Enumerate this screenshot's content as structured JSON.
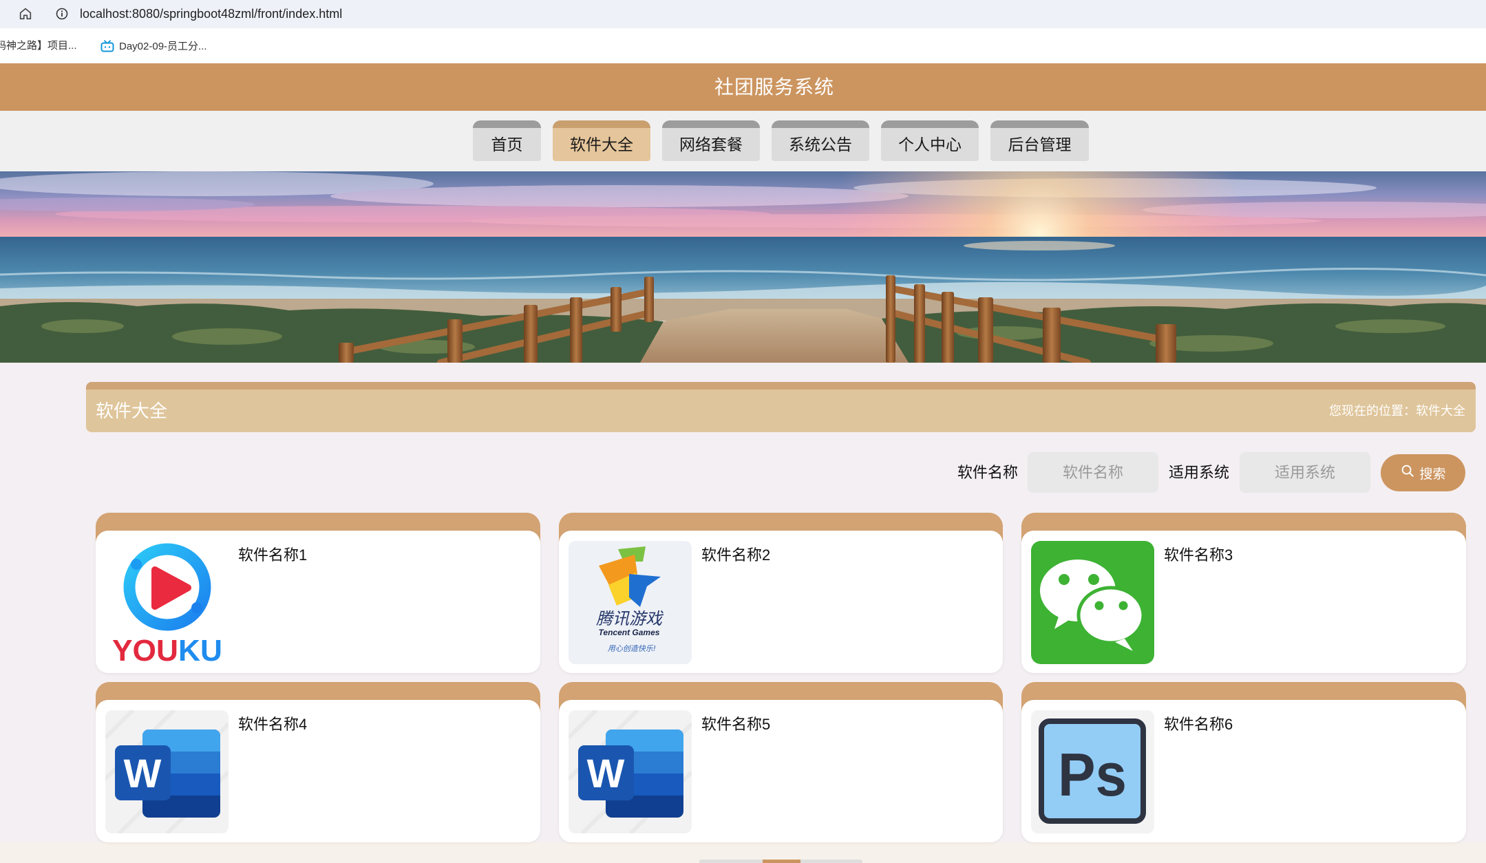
{
  "browser": {
    "url": "localhost:8080/springboot48zml/front/index.html",
    "bookmarks": [
      {
        "label": "码神之路】项目..."
      },
      {
        "label": "Day02-09-员工分...",
        "icon": "tv-icon"
      }
    ]
  },
  "header": {
    "title": "社团服务系统"
  },
  "nav": {
    "items": [
      {
        "label": "首页",
        "active": false
      },
      {
        "label": "软件大全",
        "active": true
      },
      {
        "label": "网络套餐",
        "active": false
      },
      {
        "label": "系统公告",
        "active": false
      },
      {
        "label": "个人中心",
        "active": false
      },
      {
        "label": "后台管理",
        "active": false
      }
    ]
  },
  "section": {
    "title": "软件大全",
    "location": "您现在的位置：软件大全"
  },
  "search": {
    "name_label": "软件名称",
    "name_placeholder": "软件名称",
    "name_value": "",
    "system_label": "适用系统",
    "system_placeholder": "适用系统",
    "system_value": "",
    "button_label": "搜索",
    "button_icon": "search-icon"
  },
  "software": [
    {
      "name": "软件名称1",
      "logo": "youku-logo",
      "logo_text": [
        "YOU",
        "KU"
      ]
    },
    {
      "name": "软件名称2",
      "logo": "tencent-games-logo",
      "logo_text": [
        "腾讯游戏",
        "Tencent Games",
        "用心创造快乐!"
      ]
    },
    {
      "name": "软件名称3",
      "logo": "wechat-logo"
    },
    {
      "name": "软件名称4",
      "logo": "word-logo",
      "logo_text": [
        "W"
      ]
    },
    {
      "name": "软件名称5",
      "logo": "word-logo",
      "logo_text": [
        "W"
      ]
    },
    {
      "name": "软件名称6",
      "logo": "photoshop-logo",
      "logo_text": [
        "Ps"
      ]
    }
  ],
  "colors": {
    "primary": "#cc9560",
    "section-bar": "#dfc59b",
    "section-bar-top": "#cfa477",
    "card-strip": "#d3a373",
    "nav-active": "#e5c59b",
    "nav-active-top": "#c99f6e",
    "nav-inactive": "#dcdcdc",
    "nav-inactive-top": "#9c9c9c",
    "page-bg": "#f4eff2"
  }
}
